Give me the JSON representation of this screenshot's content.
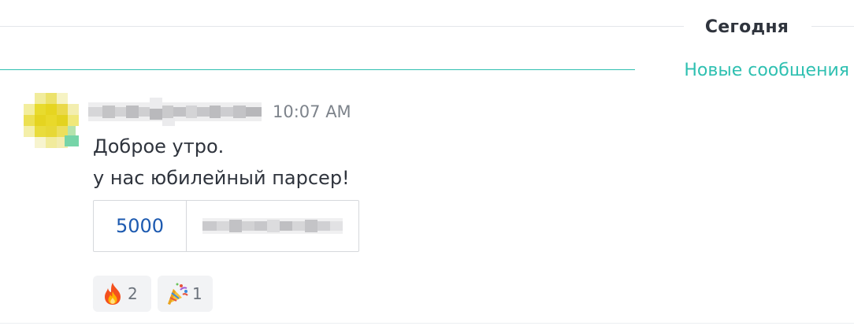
{
  "divider": {
    "day_label": "Сегодня",
    "new_messages_label": "Новые сообщения",
    "new_messages_color": "#2fc0b1"
  },
  "message": {
    "author_redacted": true,
    "avatar_redacted": true,
    "timestamp": "10:07 AM",
    "lines": [
      "Доброе утро.",
      "у нас юбилейный парсер!"
    ],
    "table": {
      "value": "5000",
      "value_color": "#1d5ab0",
      "label_redacted": true
    },
    "reactions": [
      {
        "icon": "fire-icon",
        "count": "2"
      },
      {
        "icon": "party-popper-icon",
        "count": "1"
      }
    ]
  }
}
